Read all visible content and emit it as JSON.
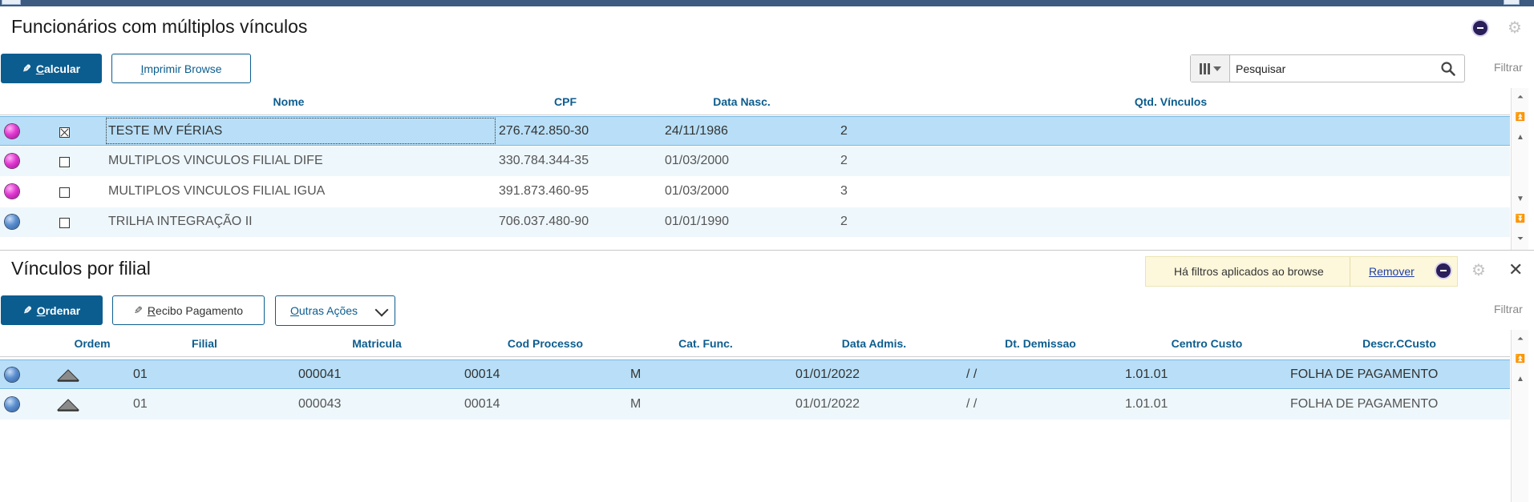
{
  "top_section": {
    "title": "Funcionários com múltiplos vínculos",
    "buttons": {
      "calcular_key": "C",
      "calcular_rest": "alcular",
      "imprimir_key": "I",
      "imprimir_rest": "mprimir Browse"
    },
    "search": {
      "placeholder": "Pesquisar",
      "value": "Pesquisar"
    },
    "filter_label": "Filtrar",
    "columns": [
      "Nome",
      "CPF",
      "Data Nasc.",
      "Qtd. Vínculos"
    ],
    "rows": [
      {
        "status": "magenta",
        "checked": true,
        "nome": "TESTE MV FÉRIAS",
        "cpf": "276.742.850-30",
        "data_nasc": "24/11/1986",
        "qtd": "2"
      },
      {
        "status": "magenta",
        "checked": false,
        "nome": "MULTIPLOS VINCULOS FILIAL DIFE",
        "cpf": "330.784.344-35",
        "data_nasc": "01/03/2000",
        "qtd": "2"
      },
      {
        "status": "magenta",
        "checked": false,
        "nome": "MULTIPLOS VINCULOS FILIAL IGUA",
        "cpf": "391.873.460-95",
        "data_nasc": "01/03/2000",
        "qtd": "3"
      },
      {
        "status": "blue",
        "checked": false,
        "nome": "TRILHA INTEGRAÇÃO II",
        "cpf": "706.037.480-90",
        "data_nasc": "01/01/1990",
        "qtd": "2"
      }
    ]
  },
  "bottom_section": {
    "title": "Vínculos por filial",
    "notice": {
      "text": "Há filtros aplicados ao browse",
      "link": "Remover"
    },
    "buttons": {
      "ordenar_key": "O",
      "ordenar_rest": "rdenar",
      "recibo_key": "R",
      "recibo_rest": "ecibo Pagamento",
      "outras_key": "O",
      "outras_rest": "utras Ações"
    },
    "filter_label": "Filtrar",
    "columns": [
      "Ordem",
      "Filial",
      "Matricula",
      "Cod Processo",
      "Cat. Func.",
      "Data Admis.",
      "Dt. Demissao",
      "Centro Custo",
      "Descr.CCusto"
    ],
    "rows": [
      {
        "status": "blue",
        "filial": "01",
        "matricula": "000041",
        "cod_processo": "00014",
        "cat_func": "M",
        "data_admis": "01/01/2022",
        "dt_demissao": "/ /",
        "centro_custo": "1.01.01",
        "descr_ccusto": "FOLHA DE PAGAMENTO"
      },
      {
        "status": "blue",
        "filial": "01",
        "matricula": "000043",
        "cod_processo": "00014",
        "cat_func": "M",
        "data_admis": "01/01/2022",
        "dt_demissao": "/ /",
        "centro_custo": "1.01.01",
        "descr_ccusto": "FOLHA DE PAGAMENTO"
      }
    ]
  },
  "colors": {
    "primary": "#0c5d8f",
    "selected_row": "#b8dff7",
    "alt_row": "#eef7fc",
    "notice_bg": "#fdf8dc"
  }
}
